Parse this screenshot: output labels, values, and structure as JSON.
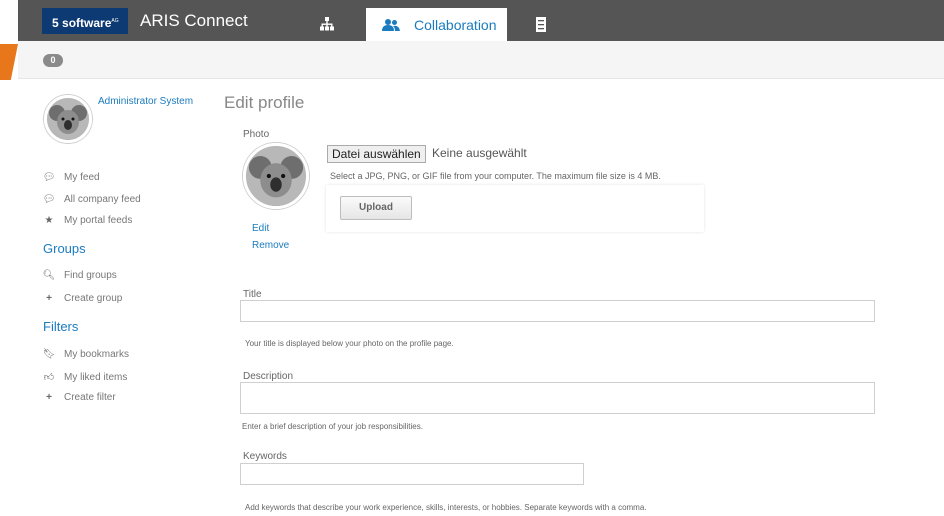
{
  "header": {
    "logo_text": "software",
    "logo_sup": "AG",
    "app_title": "ARIS Connect",
    "tabs": [
      {
        "label": "",
        "icon": "hierarchy-icon"
      },
      {
        "label": "Collaboration",
        "icon": "users-icon",
        "active": true
      },
      {
        "label": "",
        "icon": "documents-icon"
      }
    ]
  },
  "subbar": {
    "notification_count": "0"
  },
  "sidebar": {
    "user_name": "Administrator System",
    "feeds": [
      {
        "label": "My feed",
        "icon": "comments-icon"
      },
      {
        "label": "All company feed",
        "icon": "comments-icon"
      },
      {
        "label": "My portal feeds",
        "icon": "star-icon"
      }
    ],
    "groups_heading": "Groups",
    "groups": [
      {
        "label": "Find groups",
        "icon": "search-icon"
      },
      {
        "label": "Create group",
        "icon": "plus-icon"
      }
    ],
    "filters_heading": "Filters",
    "filters": [
      {
        "label": "My bookmarks",
        "icon": "bookmark-icon"
      },
      {
        "label": "My liked items",
        "icon": "thumbs-up-icon"
      },
      {
        "label": "Create filter",
        "icon": "plus-icon"
      }
    ]
  },
  "main": {
    "title": "Edit profile",
    "photo_label": "Photo",
    "file_button": "Datei auswählen",
    "file_status": "Keine ausgewählt",
    "file_hint": "Select a JPG, PNG, or GIF file from your computer. The maximum file size is 4 MB.",
    "upload_button": "Upload",
    "edit_link": "Edit",
    "remove_link": "Remove",
    "title_label": "Title",
    "title_value": "",
    "title_hint": "Your title is displayed below your photo on the profile page.",
    "description_label": "Description",
    "description_value": "",
    "description_hint": "Enter a brief description of your job responsibilities.",
    "keywords_label": "Keywords",
    "keywords_value": "",
    "keywords_hint": "Add keywords that describe your work experience, skills, interests, or hobbies. Separate keywords with a comma."
  },
  "colors": {
    "topbar": "#555555",
    "accent": "#1b7bbf",
    "logo_bg": "#0e3a73",
    "orange": "#e8761b"
  }
}
